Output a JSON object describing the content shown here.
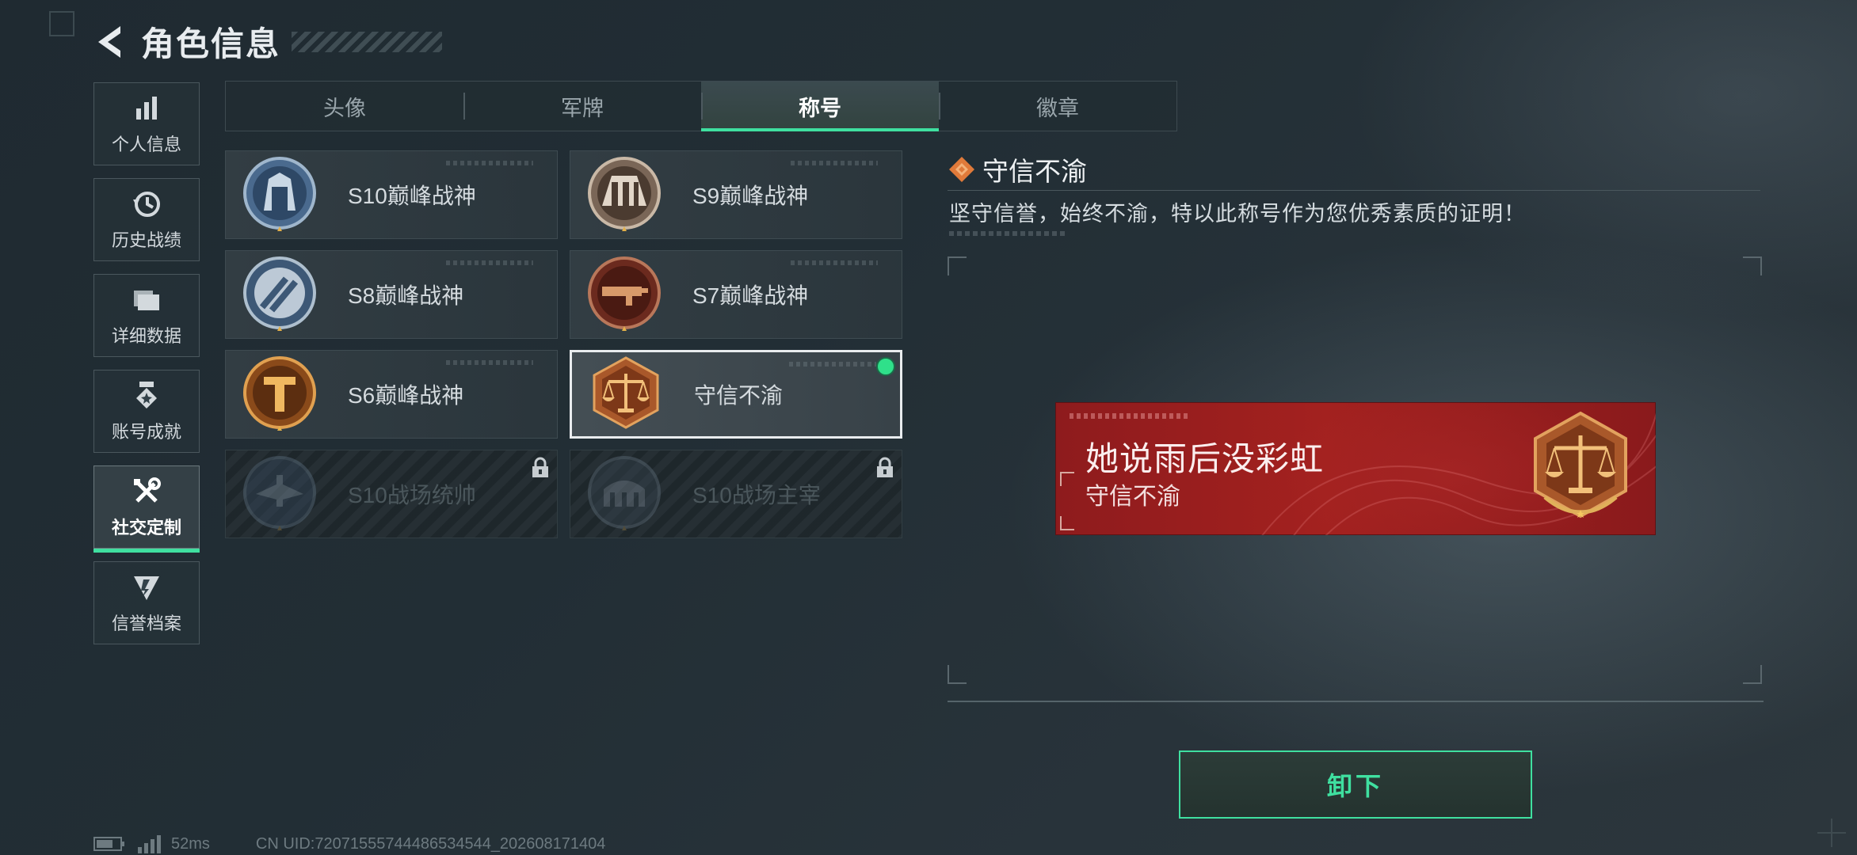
{
  "header": {
    "title": "角色信息"
  },
  "sidebar": {
    "items": [
      {
        "label": "个人信息",
        "icon": "bar-chart-icon",
        "active": false
      },
      {
        "label": "历史战绩",
        "icon": "history-icon",
        "active": false
      },
      {
        "label": "详细数据",
        "icon": "folder-icon",
        "active": false
      },
      {
        "label": "账号成就",
        "icon": "achievement-icon",
        "active": false
      },
      {
        "label": "社交定制",
        "icon": "tools-icon",
        "active": true
      },
      {
        "label": "信誉档案",
        "icon": "reputation-icon",
        "active": false
      }
    ]
  },
  "tabs": [
    {
      "label": "头像",
      "active": false
    },
    {
      "label": "军牌",
      "active": false
    },
    {
      "label": "称号",
      "active": true
    },
    {
      "label": "徽章",
      "active": false
    }
  ],
  "titles": [
    {
      "name": "S10巅峰战神",
      "emblem": "s10-peak-emblem",
      "state": "owned"
    },
    {
      "name": "S9巅峰战神",
      "emblem": "s9-peak-emblem",
      "state": "owned"
    },
    {
      "name": "S8巅峰战神",
      "emblem": "s8-peak-emblem",
      "state": "owned"
    },
    {
      "name": "S7巅峰战神",
      "emblem": "s7-peak-emblem",
      "state": "owned"
    },
    {
      "name": "S6巅峰战神",
      "emblem": "s6-peak-emblem",
      "state": "owned"
    },
    {
      "name": "守信不渝",
      "emblem": "scales-emblem",
      "state": "equipped"
    },
    {
      "name": "S10战场统帅",
      "emblem": "s10-commander-emblem",
      "state": "locked"
    },
    {
      "name": "S10战场主宰",
      "emblem": "s10-dominator-emblem",
      "state": "locked"
    }
  ],
  "detail": {
    "title": "守信不渝",
    "description": "坚守信誉，始终不渝，特以此称号作为您优秀素质的证明！"
  },
  "preview": {
    "player_name": "她说雨后没彩虹",
    "title_text": "守信不渝"
  },
  "actions": {
    "unequip_label": "卸下"
  },
  "status": {
    "ping": "52ms",
    "uid": "CN UID:72071555744486534544_202608171404"
  },
  "colors": {
    "accent": "#3fe0a0",
    "banner_red": "#a3211f",
    "emblem_bronze": "#b5652c"
  }
}
